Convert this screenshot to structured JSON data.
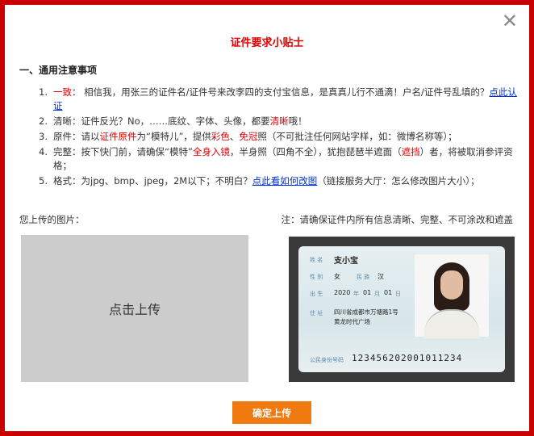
{
  "dialog": {
    "title": "证件要求小贴士",
    "close_glyph": "✕"
  },
  "section": {
    "title": "一、通用注意事项"
  },
  "rules": [
    {
      "num": "1.",
      "parts": [
        {
          "t": "一致",
          "style": "red"
        },
        {
          "t": "：  相信我，用张三的证件名/证件号来改李四的支付宝信息，是真真儿行不通滴！户名/证件号乱填的？"
        },
        {
          "t": "点此认证",
          "style": "link"
        }
      ]
    },
    {
      "num": "2.",
      "parts": [
        {
          "t": "清晰：证件反光？No，……底纹、字体、头像，都要"
        },
        {
          "t": "清晰",
          "style": "red"
        },
        {
          "t": "哦！"
        }
      ]
    },
    {
      "num": "3.",
      "parts": [
        {
          "t": "原件：请以"
        },
        {
          "t": "证件原件",
          "style": "red"
        },
        {
          "t": "为“模特儿”，提供"
        },
        {
          "t": "彩色",
          "style": "red"
        },
        {
          "t": "、"
        },
        {
          "t": "免冠",
          "style": "red"
        },
        {
          "t": "照（不可批注任何网站字样，如：微博名称等）；"
        }
      ]
    },
    {
      "num": "4.",
      "parts": [
        {
          "t": "完整：按下快门前，请确保“模特”"
        },
        {
          "t": "全身入镜",
          "style": "red"
        },
        {
          "t": "，半身照（四角不全），犹抱琵琶半遮面（"
        },
        {
          "t": "遮挡",
          "style": "red"
        },
        {
          "t": "）者，将被取消参评资格；"
        }
      ]
    },
    {
      "num": "5.",
      "parts": [
        {
          "t": "格式：为jpg、bmp、jpeg，2M以下；不明白？"
        },
        {
          "t": "点此看如何改图",
          "style": "link"
        },
        {
          "t": "（链接服务大厅：怎么修改图片大小）；"
        }
      ]
    }
  ],
  "upload": {
    "label": "您上传的图片：",
    "button_text": "点击上传"
  },
  "note": {
    "label": "注：请确保证件内所有信息清晰、完整、不可涂改和遮盖"
  },
  "sample_card": {
    "name_label": "姓 名",
    "name": "支小宝",
    "gender_label": "性 别",
    "gender": "女",
    "ethnicity_label": "民 族",
    "ethnicity": "汉",
    "birth_label": "出 生",
    "birth_year": "2020",
    "birth_year_unit": "年",
    "birth_month": "01",
    "birth_month_unit": "月",
    "birth_day": "01",
    "birth_day_unit": "日",
    "address_label": "住 址",
    "address_line1": "四川省成都市万塘路1号",
    "address_line2": "黄龙时代广场",
    "id_label": "公民身份号码",
    "id_number": "123456202001011234"
  },
  "confirm_button": "确定上传",
  "colors": {
    "frame": "#c80000",
    "title": "#e00000",
    "highlight": "#e00000",
    "link": "#0033cc",
    "upload_box": "#cccccc",
    "confirm": "#f07a10"
  }
}
